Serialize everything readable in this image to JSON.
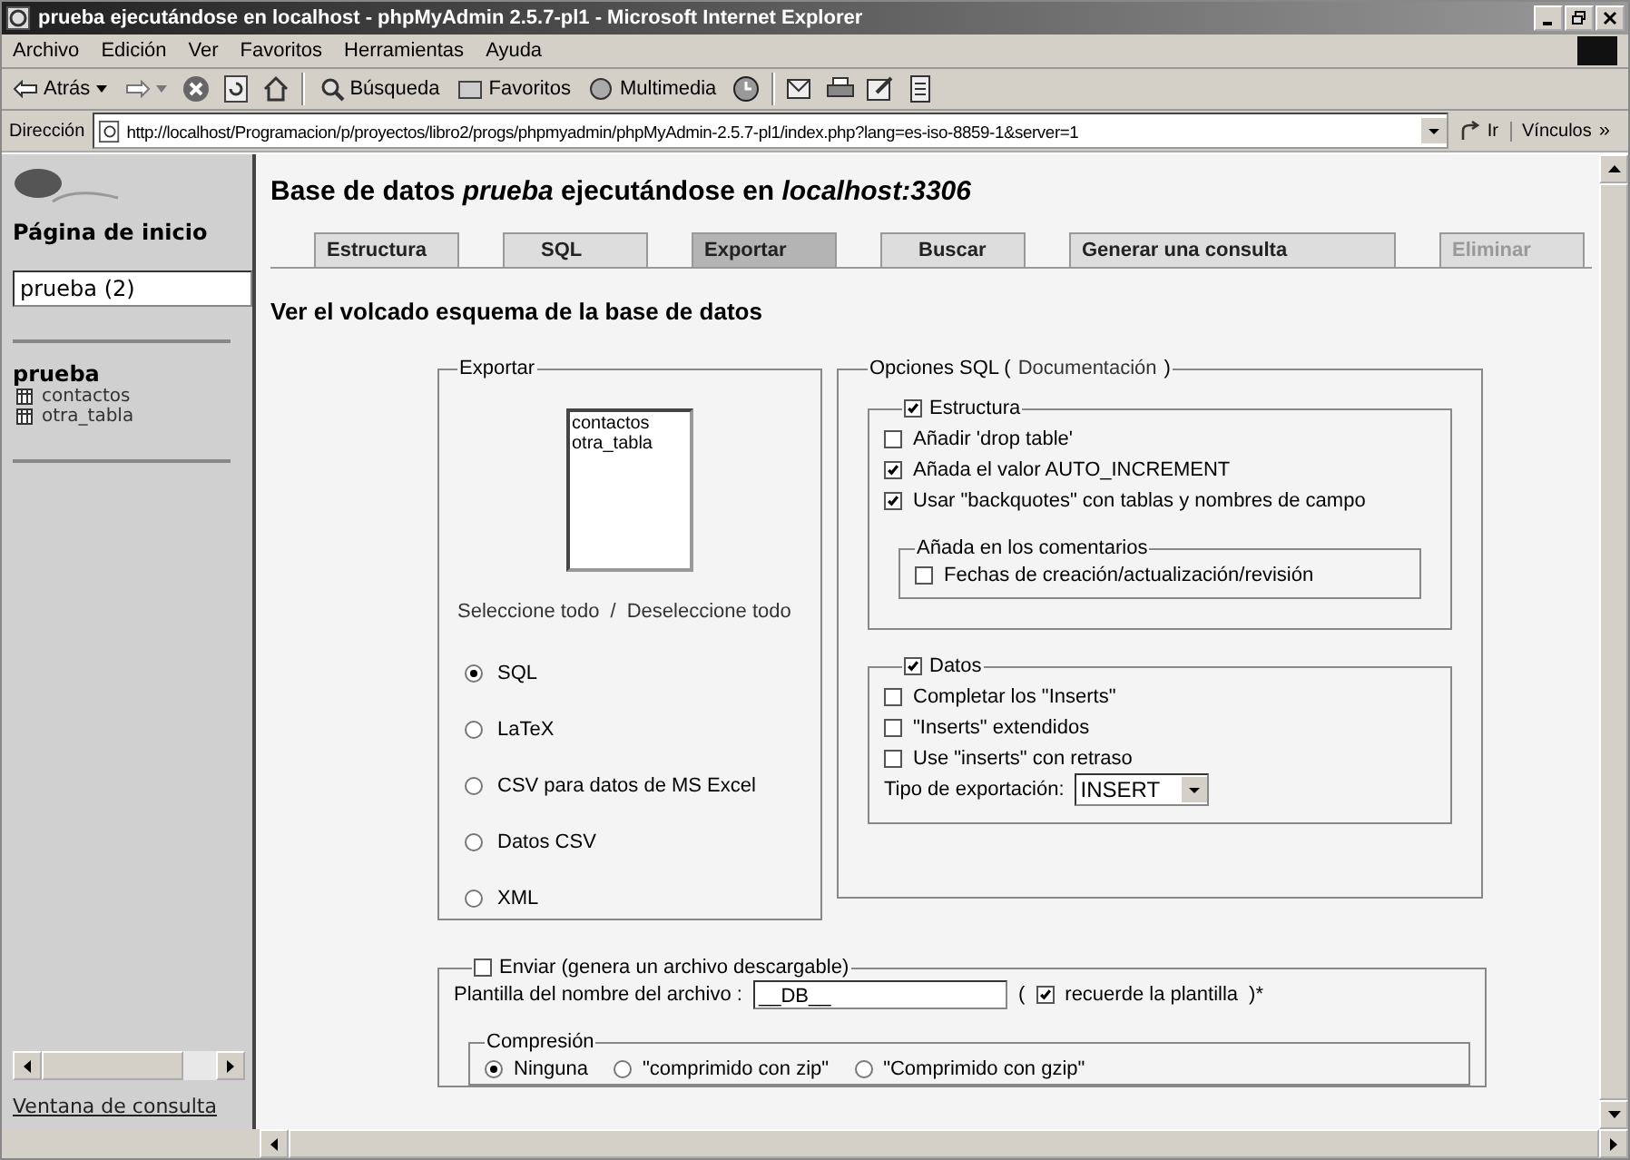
{
  "window": {
    "title": "prueba ejecutándose en localhost - phpMyAdmin 2.5.7-pl1 - Microsoft Internet Explorer"
  },
  "menu": [
    "Archivo",
    "Edición",
    "Ver",
    "Favoritos",
    "Herramientas",
    "Ayuda"
  ],
  "toolbar": {
    "back": "Atrás",
    "search": "Búsqueda",
    "favorites": "Favoritos",
    "media": "Multimedia"
  },
  "address": {
    "label": "Dirección",
    "value": "http://localhost/Programacion/p/proyectos/libro2/progs/phpmyadmin/phpMyAdmin-2.5.7-pl1/index.php?lang=es-iso-8859-1&server=1",
    "go": "Ir",
    "links": "Vínculos",
    "links_more": "»"
  },
  "sidebar": {
    "home": "Página de inicio",
    "db_select": "prueba (2)",
    "db_name": "prueba",
    "tables": [
      "contactos",
      "otra_tabla"
    ],
    "query_link": "Ventana de consulta"
  },
  "main": {
    "heading": "Base de datos *prueba* ejecutándose en *localhost:3306*",
    "tabs": [
      {
        "label": "Estructura",
        "selected": false,
        "disabled": false
      },
      {
        "label": "SQL",
        "selected": false,
        "disabled": false
      },
      {
        "label": "Exportar",
        "selected": true,
        "disabled": false
      },
      {
        "label": "Buscar",
        "selected": false,
        "disabled": false
      },
      {
        "label": "Generar una consulta",
        "selected": false,
        "disabled": false
      },
      {
        "label": "Eliminar",
        "selected": false,
        "disabled": true
      }
    ],
    "subtitle": "Ver el volcado esquema de la base de datos",
    "export": {
      "legend": "Exportar",
      "tables": [
        "contactos",
        "otra_tabla"
      ],
      "select_all": "Seleccione todo",
      "separator": "/",
      "deselect_all": "Deseleccione todo",
      "formats": [
        {
          "label": "SQL",
          "selected": true
        },
        {
          "label": "LaTeX",
          "selected": false
        },
        {
          "label": "CSV para datos de MS Excel",
          "selected": false
        },
        {
          "label": "Datos CSV",
          "selected": false
        },
        {
          "label": "XML",
          "selected": false
        }
      ]
    },
    "sql_options": {
      "legend_start": "Opciones SQL (",
      "legend_link": "Documentación",
      "legend_end": ")",
      "structure": {
        "label": "Estructura",
        "checked": true,
        "options": [
          {
            "label": "Añadir 'drop table'",
            "checked": false
          },
          {
            "label": "Añada el valor AUTO_INCREMENT",
            "checked": true
          },
          {
            "label": "Usar \"backquotes\" con tablas y nombres de campo",
            "checked": true
          }
        ],
        "comments": {
          "legend": "Añada en los comentarios",
          "options": [
            {
              "label": "Fechas de creación/actualización/revisión",
              "checked": false
            }
          ]
        }
      },
      "data": {
        "label": "Datos",
        "checked": true,
        "options": [
          {
            "label": "Completar los \"Inserts\"",
            "checked": false
          },
          {
            "label": "\"Inserts\" extendidos",
            "checked": false
          },
          {
            "label": "Use \"inserts\" con retraso",
            "checked": false
          }
        ],
        "export_type_label": "Tipo de exportación:",
        "export_type_value": "INSERT"
      }
    },
    "send": {
      "label": "Enviar (genera un archivo descargable)",
      "checked": false,
      "filename_label": "Plantilla del nombre del archivo :",
      "filename_value": "__DB__",
      "remember_open": "(",
      "remember_label": "recuerde la plantilla",
      "remember_checked": true,
      "remember_close": ")*",
      "compression": {
        "legend": "Compresión",
        "options": [
          {
            "label": "Ninguna",
            "selected": true
          },
          {
            "label": "\"comprimido con zip\"",
            "selected": false
          },
          {
            "label": "\"Comprimido con gzip\"",
            "selected": false
          }
        ]
      }
    }
  }
}
